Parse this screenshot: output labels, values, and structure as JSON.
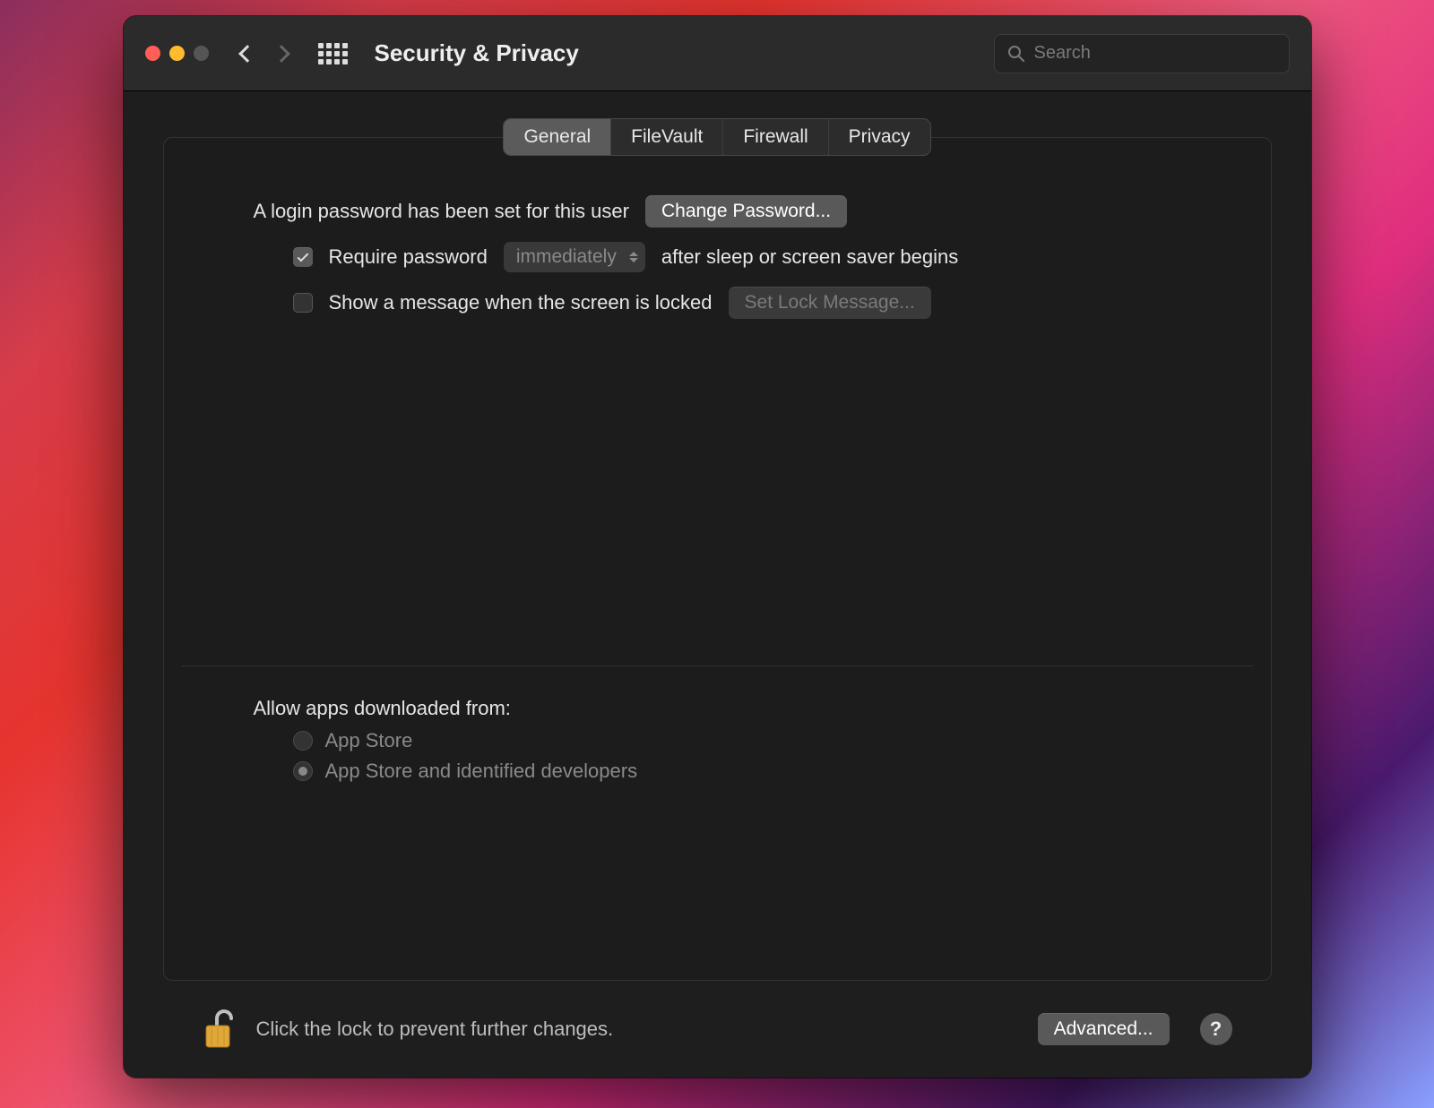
{
  "header": {
    "title": "Security & Privacy",
    "search_placeholder": "Search"
  },
  "tabs": [
    {
      "label": "General",
      "active": true
    },
    {
      "label": "FileVault",
      "active": false
    },
    {
      "label": "Firewall",
      "active": false
    },
    {
      "label": "Privacy",
      "active": false
    }
  ],
  "login": {
    "status_text": "A login password has been set for this user",
    "change_button": "Change Password...",
    "require_pw_prefix": "Require password",
    "require_pw_delay": "immediately",
    "require_pw_suffix": "after sleep or screen saver begins",
    "show_message_label": "Show a message when the screen is locked",
    "set_lock_message_button": "Set Lock Message..."
  },
  "gatekeeper": {
    "heading": "Allow apps downloaded from:",
    "options": [
      {
        "label": "App Store",
        "selected": false
      },
      {
        "label": "App Store and identified developers",
        "selected": true
      }
    ]
  },
  "footer": {
    "lock_text": "Click the lock to prevent further changes.",
    "advanced_button": "Advanced...",
    "help_label": "?"
  }
}
